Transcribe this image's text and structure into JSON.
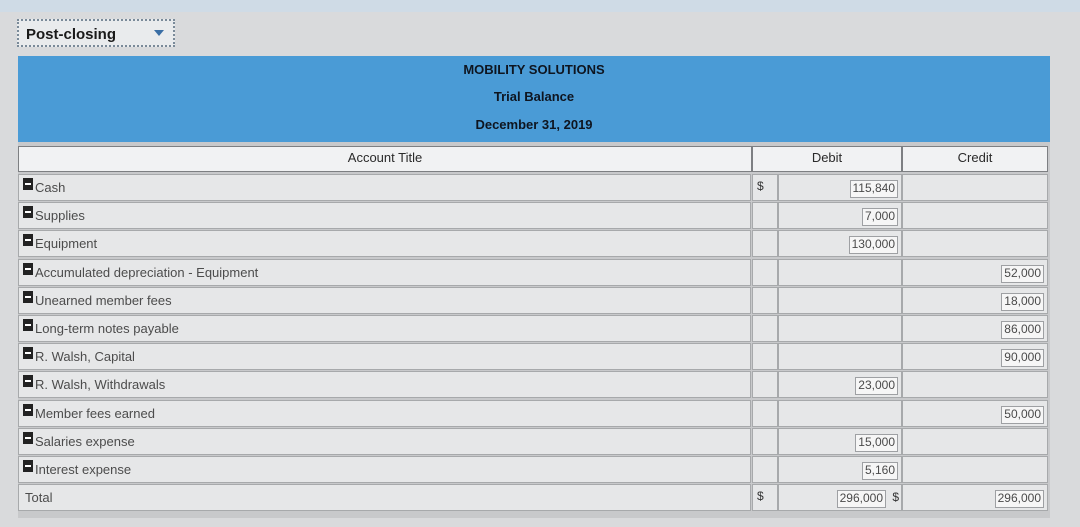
{
  "dropdown": {
    "selected": "Post-closing"
  },
  "header": {
    "company": "MOBILITY SOLUTIONS",
    "statement": "Trial Balance",
    "date": "December 31, 2019"
  },
  "columns": {
    "title": "Account Title",
    "debit": "Debit",
    "credit": "Credit"
  },
  "rows": [
    {
      "title": "Cash",
      "sign": "$",
      "debit": "115,840",
      "credit": ""
    },
    {
      "title": "Supplies",
      "sign": "",
      "debit": "7,000",
      "credit": ""
    },
    {
      "title": "Equipment",
      "sign": "",
      "debit": "130,000",
      "credit": ""
    },
    {
      "title": "Accumulated depreciation - Equipment",
      "sign": "",
      "debit": "",
      "credit": "52,000"
    },
    {
      "title": "Unearned member fees",
      "sign": "",
      "debit": "",
      "credit": "18,000"
    },
    {
      "title": "Long-term notes payable",
      "sign": "",
      "debit": "",
      "credit": "86,000"
    },
    {
      "title": "R. Walsh, Capital",
      "sign": "",
      "debit": "",
      "credit": "90,000"
    },
    {
      "title": "R. Walsh, Withdrawals",
      "sign": "",
      "debit": "23,000",
      "credit": ""
    },
    {
      "title": "Member fees earned",
      "sign": "",
      "debit": "",
      "credit": "50,000"
    },
    {
      "title": "Salaries expense",
      "sign": "",
      "debit": "15,000",
      "credit": ""
    },
    {
      "title": "Interest expense",
      "sign": "",
      "debit": "5,160",
      "credit": ""
    }
  ],
  "total": {
    "title": "Total",
    "sign": "$",
    "debit": "296,000",
    "credit_sign": "$",
    "credit": "296,000"
  }
}
